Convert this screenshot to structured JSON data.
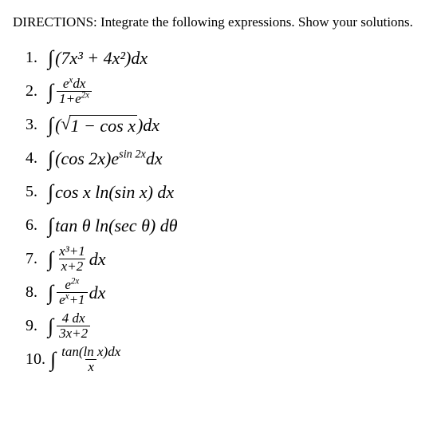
{
  "directions": "DIRECTIONS: Integrate the following expressions. Show your solutions.",
  "items": [
    {
      "n": "1.",
      "type": "plain",
      "body": "(7x³ + 4x²)dx"
    },
    {
      "n": "2.",
      "type": "frac",
      "top_html": "e<sup>x</sup>dx",
      "bot_html": "1+e<sup>2x</sup>"
    },
    {
      "n": "3.",
      "type": "sqrt",
      "inside": "1 − cos x",
      "after": ")dx",
      "before": "("
    },
    {
      "n": "4.",
      "type": "plain_html",
      "body": "(cos 2x)e<sup>sin 2x</sup>dx"
    },
    {
      "n": "5.",
      "type": "plain",
      "body": "cos x ln(sin x) dx"
    },
    {
      "n": "6.",
      "type": "plain",
      "body": "tan θ ln(sec θ) dθ"
    },
    {
      "n": "7.",
      "type": "frac_dx",
      "top_html": "x³+1",
      "bot_html": "x+2",
      "after": "dx"
    },
    {
      "n": "8.",
      "type": "frac_dx",
      "top_html": "e<sup>2x</sup>",
      "bot_html": "e<sup>x</sup>+1",
      "after": "dx"
    },
    {
      "n": "9.",
      "type": "frac",
      "top_html": "4 dx",
      "bot_html": "3x+2"
    },
    {
      "n": "10.",
      "type": "frac",
      "top_html": "tan(ln x)dx",
      "bot_html": "x"
    }
  ]
}
